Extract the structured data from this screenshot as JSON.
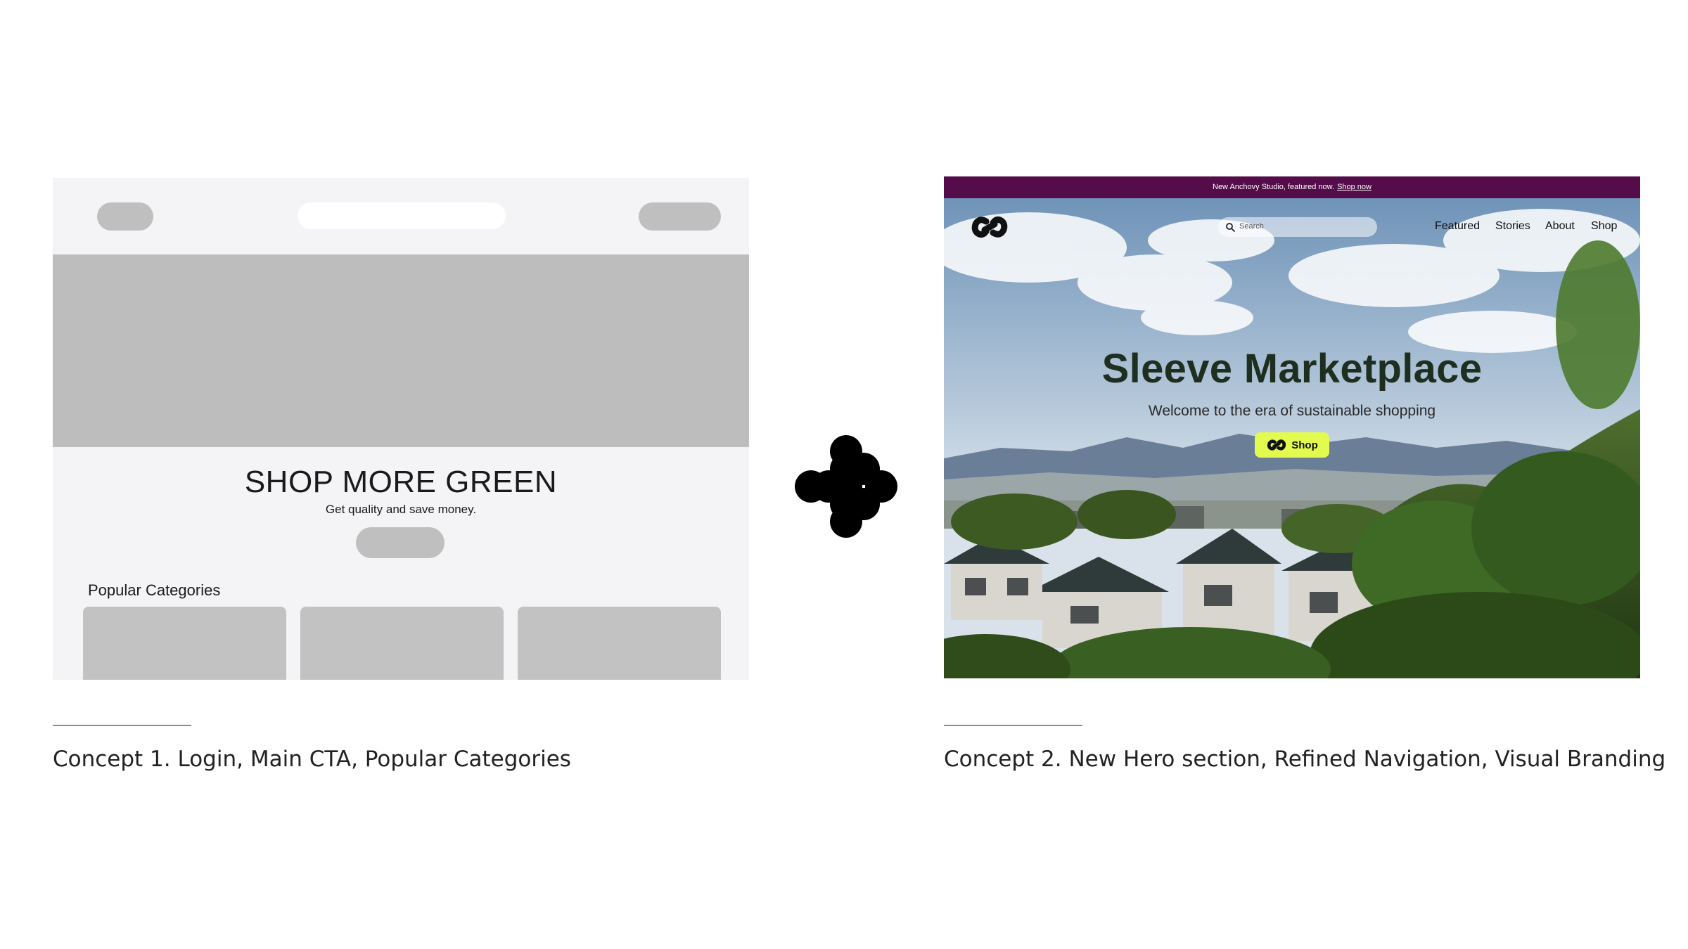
{
  "concept1": {
    "headline": "SHOP MORE GREEN",
    "subheadline": "Get quality and save money.",
    "categories_heading": "Popular Categories",
    "caption": "Concept 1. Login, Main CTA, Popular Categories",
    "colors": {
      "background": "#f4f4f6",
      "placeholder": "#bdbdbd"
    }
  },
  "transition_icon": "arrow-right-icon",
  "concept2": {
    "announcement": {
      "text": "New Anchovy Studio, featured now.",
      "link": "Shop now"
    },
    "search": {
      "placeholder": "Search"
    },
    "nav": [
      "Featured",
      "Stories",
      "About",
      "Shop"
    ],
    "title": "Sleeve Marketplace",
    "tagline": "Welcome to the era of sustainable shopping",
    "cta_label": "Shop",
    "caption": "Concept 2. New Hero section, Refined Navigation, Visual Branding",
    "colors": {
      "announcement_bar": "#540d4a",
      "cta": "#e2fb4e",
      "title": "#1f2f1f"
    }
  }
}
